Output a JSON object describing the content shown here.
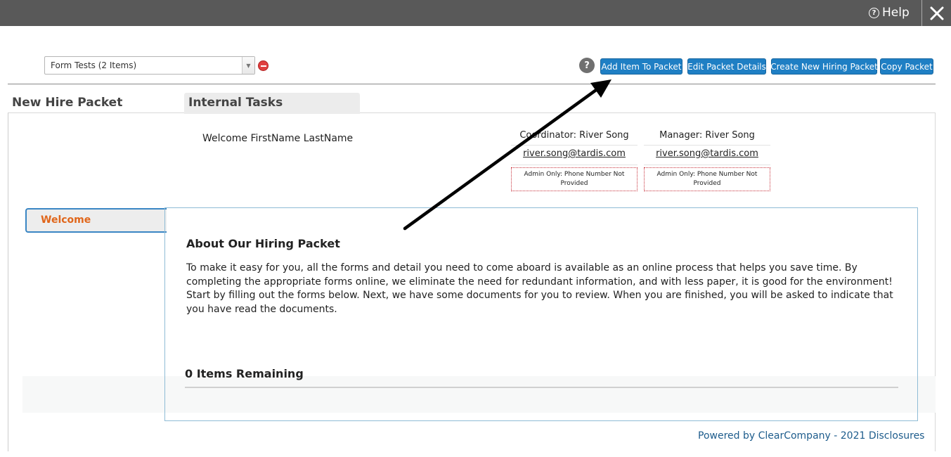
{
  "topbar": {
    "help_label": "Help"
  },
  "packet_select": {
    "value": "Form Tests (2 Items)"
  },
  "toolbar": {
    "help_q": "?",
    "add_item": "Add Item To Packet",
    "edit_details": "Edit Packet Details",
    "create_new": "Create New Hiring Packet",
    "copy": "Copy Packet"
  },
  "tabs": {
    "new_hire": "New Hire Packet",
    "internal": "Internal Tasks"
  },
  "welcome": "Welcome FirstName LastName",
  "coordinator": {
    "role": "Coordinator: River Song",
    "email": "river.song@tardis.com",
    "phone": "Admin Only: Phone Number Not Provided"
  },
  "manager": {
    "role": "Manager: River Song",
    "email": "river.song@tardis.com",
    "phone": "Admin Only: Phone Number Not Provided"
  },
  "sidebar": {
    "welcome_tab": "Welcome"
  },
  "main": {
    "title": "About Our Hiring Packet",
    "body": "To make it easy for you, all the forms and detail you need to come aboard is available as an online process that helps you save time. By completing the appropriate forms online, we eliminate the need for redundant information, and with less paper, it is good for the environment! Start by filling out the forms below. Next, we have some documents for you to review. When you are finished, you will be asked to indicate that you have read the documents.",
    "items_remaining": "0 Items Remaining"
  },
  "footer": {
    "powered": "Powered by ClearCompany - 2021 Disclosures"
  },
  "colors": {
    "topbar": "#595959",
    "button": "#1f7fc4",
    "accent_orange": "#e0661b",
    "link_blue": "#1d5c8c"
  },
  "icons": [
    "help-circle-icon",
    "close-icon",
    "dropdown-arrow-icon",
    "remove-icon",
    "question-icon",
    "annotation-arrow"
  ]
}
